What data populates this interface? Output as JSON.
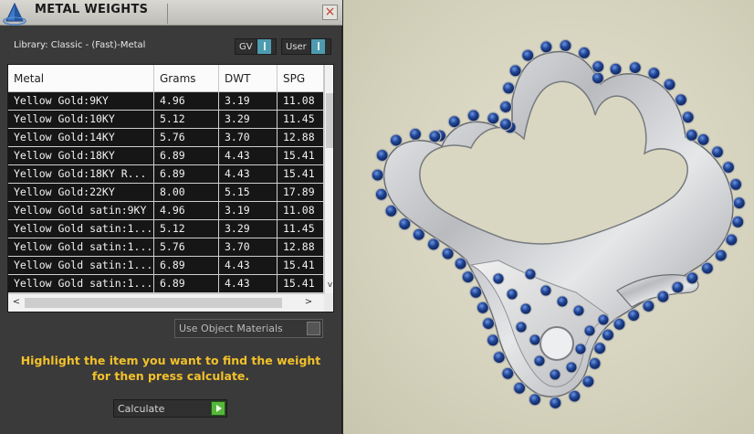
{
  "window": {
    "title": "METAL WEIGHTS",
    "close_glyph": "×"
  },
  "library": {
    "text": "Library: Classic - (Fast)-Metal"
  },
  "toggles": {
    "gv_label": "GV",
    "user_label": "User"
  },
  "table": {
    "columns": [
      "Metal",
      "Grams",
      "DWT",
      "SPG"
    ],
    "rows": [
      [
        "Yellow Gold:9KY",
        "4.96",
        "3.19",
        "11.08"
      ],
      [
        "Yellow Gold:10KY",
        "5.12",
        "3.29",
        "11.45"
      ],
      [
        "Yellow Gold:14KY",
        "5.76",
        "3.70",
        "12.88"
      ],
      [
        "Yellow Gold:18KY",
        "6.89",
        "4.43",
        "15.41"
      ],
      [
        "Yellow Gold:18KY R...",
        "6.89",
        "4.43",
        "15.41"
      ],
      [
        "Yellow Gold:22KY",
        "8.00",
        "5.15",
        "17.89"
      ],
      [
        "Yellow Gold satin:9KY",
        "4.96",
        "3.19",
        "11.08"
      ],
      [
        "Yellow Gold satin:1...",
        "5.12",
        "3.29",
        "11.45"
      ],
      [
        "Yellow Gold satin:1...",
        "5.76",
        "3.70",
        "12.88"
      ],
      [
        "Yellow Gold satin:1...",
        "6.89",
        "4.43",
        "15.41"
      ],
      [
        "Yellow Gold satin:1...",
        "6.89",
        "4.43",
        "15.41"
      ]
    ],
    "scroll_left_glyph": "<",
    "scroll_right_glyph": ">",
    "scroll_down_glyph": "v"
  },
  "use_object_materials": {
    "label": "Use Object Materials"
  },
  "hint": {
    "line1": "Highlight the item you want to find the weight",
    "line2": "for then press calculate."
  },
  "calculate": {
    "label": "Calculate"
  },
  "colors": {
    "hint_text": "#f3c12a",
    "gemstone": "#1d3f8f",
    "metal": "#c9cacc",
    "toggle_on": "#4e9bb0",
    "calculate_go": "#56b83a"
  },
  "icons": {
    "app": "pyramid-logo-icon",
    "close": "close-icon",
    "calculate": "play-arrow-icon"
  }
}
